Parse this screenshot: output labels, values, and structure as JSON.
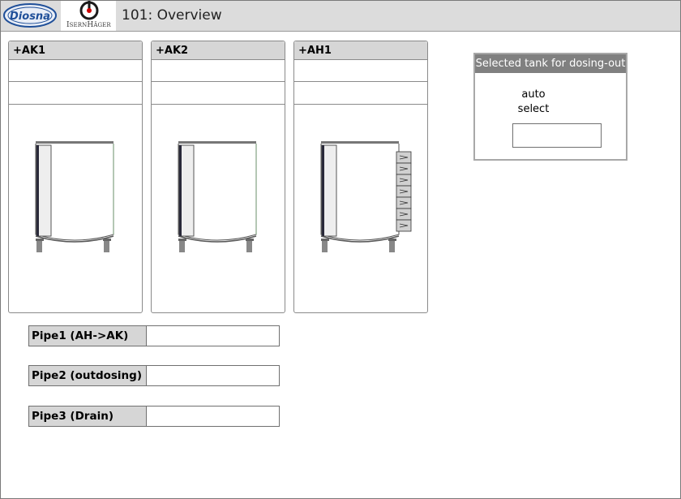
{
  "header": {
    "title": "101: Overview",
    "logos": {
      "diosna": "Diosna",
      "isernhager": "IsernHäger"
    }
  },
  "tanks": [
    {
      "id": "+AK1",
      "row1": "",
      "row2": "",
      "graphic": "tank-icon",
      "has_heat_exchanger": false
    },
    {
      "id": "+AK2",
      "row1": "",
      "row2": "",
      "graphic": "tank-icon",
      "has_heat_exchanger": false
    },
    {
      "id": "+AH1",
      "row1": "",
      "row2": "",
      "graphic": "tank-icon",
      "has_heat_exchanger": true
    }
  ],
  "dosing_out": {
    "title": "Selected tank for dosing-out",
    "mode_line1": "auto",
    "mode_line2": "select",
    "value": ""
  },
  "pipes": [
    {
      "label": "Pipe1 (AH->AK)",
      "value": ""
    },
    {
      "label": "Pipe2 (outdosing)",
      "value": ""
    },
    {
      "label": "Pipe3 (Drain)",
      "value": ""
    }
  ],
  "colors": {
    "header_bg": "#dcdcdc",
    "panel_title_bg": "#d6d6d6",
    "selected_title_bg": "#808080",
    "border": "#8a8a8a",
    "diosna_blue": "#1f4f99"
  }
}
